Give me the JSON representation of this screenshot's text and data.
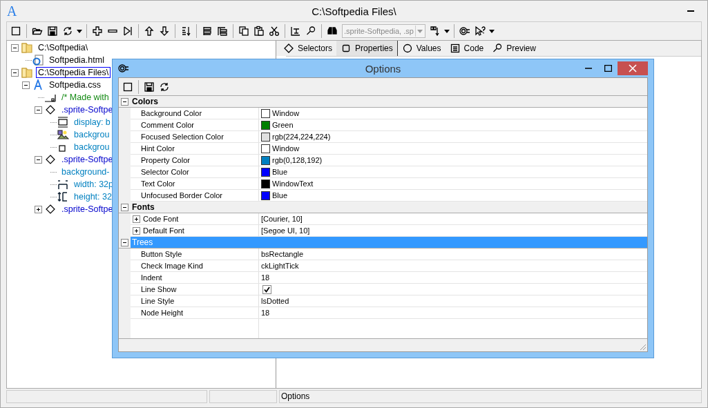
{
  "window": {
    "app_icon": "A",
    "title": "C:\\Softpedia Files\\"
  },
  "toolbar": {
    "combo": {
      "value": ".sprite-Softpedia, .sp",
      "disabled": true
    }
  },
  "tree": [
    {
      "label": "C:\\Softpedia\\",
      "kind": "folder",
      "expanded": true,
      "selected": false,
      "children": [
        {
          "label": "Softpedia.html",
          "kind": "html",
          "selected": false
        }
      ]
    },
    {
      "label": "C:\\Softpedia Files\\",
      "kind": "folder",
      "expanded": true,
      "selected": true,
      "children": [
        {
          "label": "Softpedia.css",
          "kind": "css",
          "expanded": true,
          "selected": false,
          "children": [
            {
              "label": "/* Made with",
              "kind": "comment",
              "selected": false
            },
            {
              "label": ".sprite-Softpe",
              "kind": "selector",
              "expanded": true,
              "selected": false,
              "children": [
                {
                  "label": "display: b",
                  "kind": "display",
                  "selected": false
                },
                {
                  "label": "backgrou",
                  "kind": "image",
                  "selected": false
                },
                {
                  "label": "backgrou",
                  "kind": "square",
                  "selected": false
                }
              ]
            },
            {
              "label": ".sprite-Softpe",
              "kind": "selector",
              "expanded": true,
              "selected": false,
              "children": [
                {
                  "label": "background-",
                  "kind": "plain",
                  "selected": false
                },
                {
                  "label": "width: 32p",
                  "kind": "width",
                  "selected": false
                },
                {
                  "label": "height: 32",
                  "kind": "height",
                  "selected": false
                }
              ]
            },
            {
              "label": ".sprite-Softpe",
              "kind": "selector",
              "expanded": false,
              "selected": false
            }
          ]
        }
      ]
    }
  ],
  "tabs": [
    {
      "label": "Selectors",
      "selected": false
    },
    {
      "label": "Properties",
      "selected": true
    },
    {
      "label": "Values",
      "selected": false
    },
    {
      "label": "Code",
      "selected": false
    },
    {
      "label": "Preview",
      "selected": false
    }
  ],
  "status_bar": {
    "text": "Options"
  },
  "dialog": {
    "title": "Options",
    "categories": [
      {
        "name": "Colors",
        "expanded": true,
        "selected": false,
        "rows": [
          {
            "kind": "color",
            "name": "Background Color",
            "value": "Window",
            "color": "#ffffff"
          },
          {
            "kind": "color",
            "name": "Comment Color",
            "value": "Green",
            "color": "#008000"
          },
          {
            "kind": "color",
            "name": "Focused Selection Color",
            "value": "rgb(224,224,224)",
            "color": "#e0e0e0"
          },
          {
            "kind": "color",
            "name": "Hint Color",
            "value": "Window",
            "color": "#ffffff"
          },
          {
            "kind": "color",
            "name": "Property Color",
            "value": "rgb(0,128,192)",
            "color": "#0080c0"
          },
          {
            "kind": "color",
            "name": "Selector Color",
            "value": "Blue",
            "color": "#0000ff"
          },
          {
            "kind": "color",
            "name": "Text Color",
            "value": "WindowText",
            "color": "#000000"
          },
          {
            "kind": "color",
            "name": "Unfocused Border Color",
            "value": "Blue",
            "color": "#0000ff"
          }
        ]
      },
      {
        "name": "Fonts",
        "expanded": true,
        "selected": false,
        "rows": [
          {
            "kind": "font",
            "name": "Code Font",
            "value": "[Courier, 10]",
            "expanded": false
          },
          {
            "kind": "font",
            "name": "Default Font",
            "value": "[Segoe UI, 10]",
            "expanded": false
          }
        ]
      },
      {
        "name": "Trees",
        "expanded": true,
        "selected": true,
        "rows": [
          {
            "kind": "text",
            "name": "Button Style",
            "value": "bsRectangle"
          },
          {
            "kind": "text",
            "name": "Check Image Kind",
            "value": "ckLightTick"
          },
          {
            "kind": "text",
            "name": "Indent",
            "value": "18"
          },
          {
            "kind": "check",
            "name": "Line Show",
            "checked": true
          },
          {
            "kind": "text",
            "name": "Line Style",
            "value": "lsDotted"
          },
          {
            "kind": "text",
            "name": "Node Height",
            "value": "18"
          }
        ]
      }
    ]
  }
}
